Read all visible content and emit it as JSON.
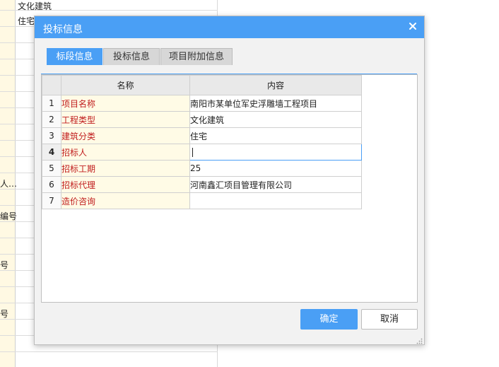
{
  "background": {
    "cells": [
      "文化建筑",
      "住宅"
    ],
    "partial_labels": [
      "人…",
      "编号",
      "号",
      "号"
    ]
  },
  "dialog": {
    "title": "投标信息",
    "tabs": [
      {
        "label": "标段信息",
        "active": true
      },
      {
        "label": "投标信息",
        "active": false
      },
      {
        "label": "项目附加信息",
        "active": false
      }
    ],
    "table": {
      "headers": {
        "name": "名称",
        "content": "内容"
      },
      "rows": [
        {
          "num": "1",
          "name": "项目名称",
          "value": "南阳市某单位军史浮雕墙工程项目"
        },
        {
          "num": "2",
          "name": "工程类型",
          "value": "文化建筑"
        },
        {
          "num": "3",
          "name": "建筑分类",
          "value": "住宅"
        },
        {
          "num": "4",
          "name": "招标人",
          "value": ""
        },
        {
          "num": "5",
          "name": "招标工期",
          "value": "25"
        },
        {
          "num": "6",
          "name": "招标代理",
          "value": "河南鑫汇项目管理有限公司"
        },
        {
          "num": "7",
          "name": "造价咨询",
          "value": ""
        }
      ]
    },
    "buttons": {
      "ok": "确定",
      "cancel": "取消"
    },
    "colors": {
      "accent": "#4a9ff5",
      "required_label": "#c01d1d",
      "header_highlight": "#fde5c6"
    }
  }
}
